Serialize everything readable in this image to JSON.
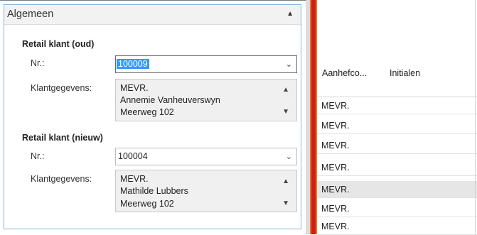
{
  "panel": {
    "title": "Algemeen",
    "collapse_icon": "chevron-up-icon"
  },
  "old_customer": {
    "section_title": "Retail klant (oud)",
    "nr_label": "Nr.:",
    "nr_value": "100009",
    "info_label": "Klantgegevens:",
    "info_lines": [
      "MEVR.",
      "Annemie Vanheuverswyn",
      "Meerweg 102"
    ]
  },
  "new_customer": {
    "section_title": "Retail klant (nieuw)",
    "nr_label": "Nr.:",
    "nr_value": "100004",
    "info_label": "Klantgegevens:",
    "info_lines": [
      "MEVR.",
      "Mathilde Lubbers",
      "Meerweg 102"
    ]
  },
  "grid": {
    "columns": [
      "Aanhefco...",
      "Initialen"
    ],
    "rows": [
      "MEVR.",
      "MEVR.",
      "MEVR.",
      "MEVR.",
      "MEVR.",
      "MEVR.",
      "MEVR."
    ],
    "selected_row": 4
  },
  "colors": {
    "accent_border": "#86b0d8",
    "selection": "#3399ff",
    "splitter": "#cc1f16"
  }
}
